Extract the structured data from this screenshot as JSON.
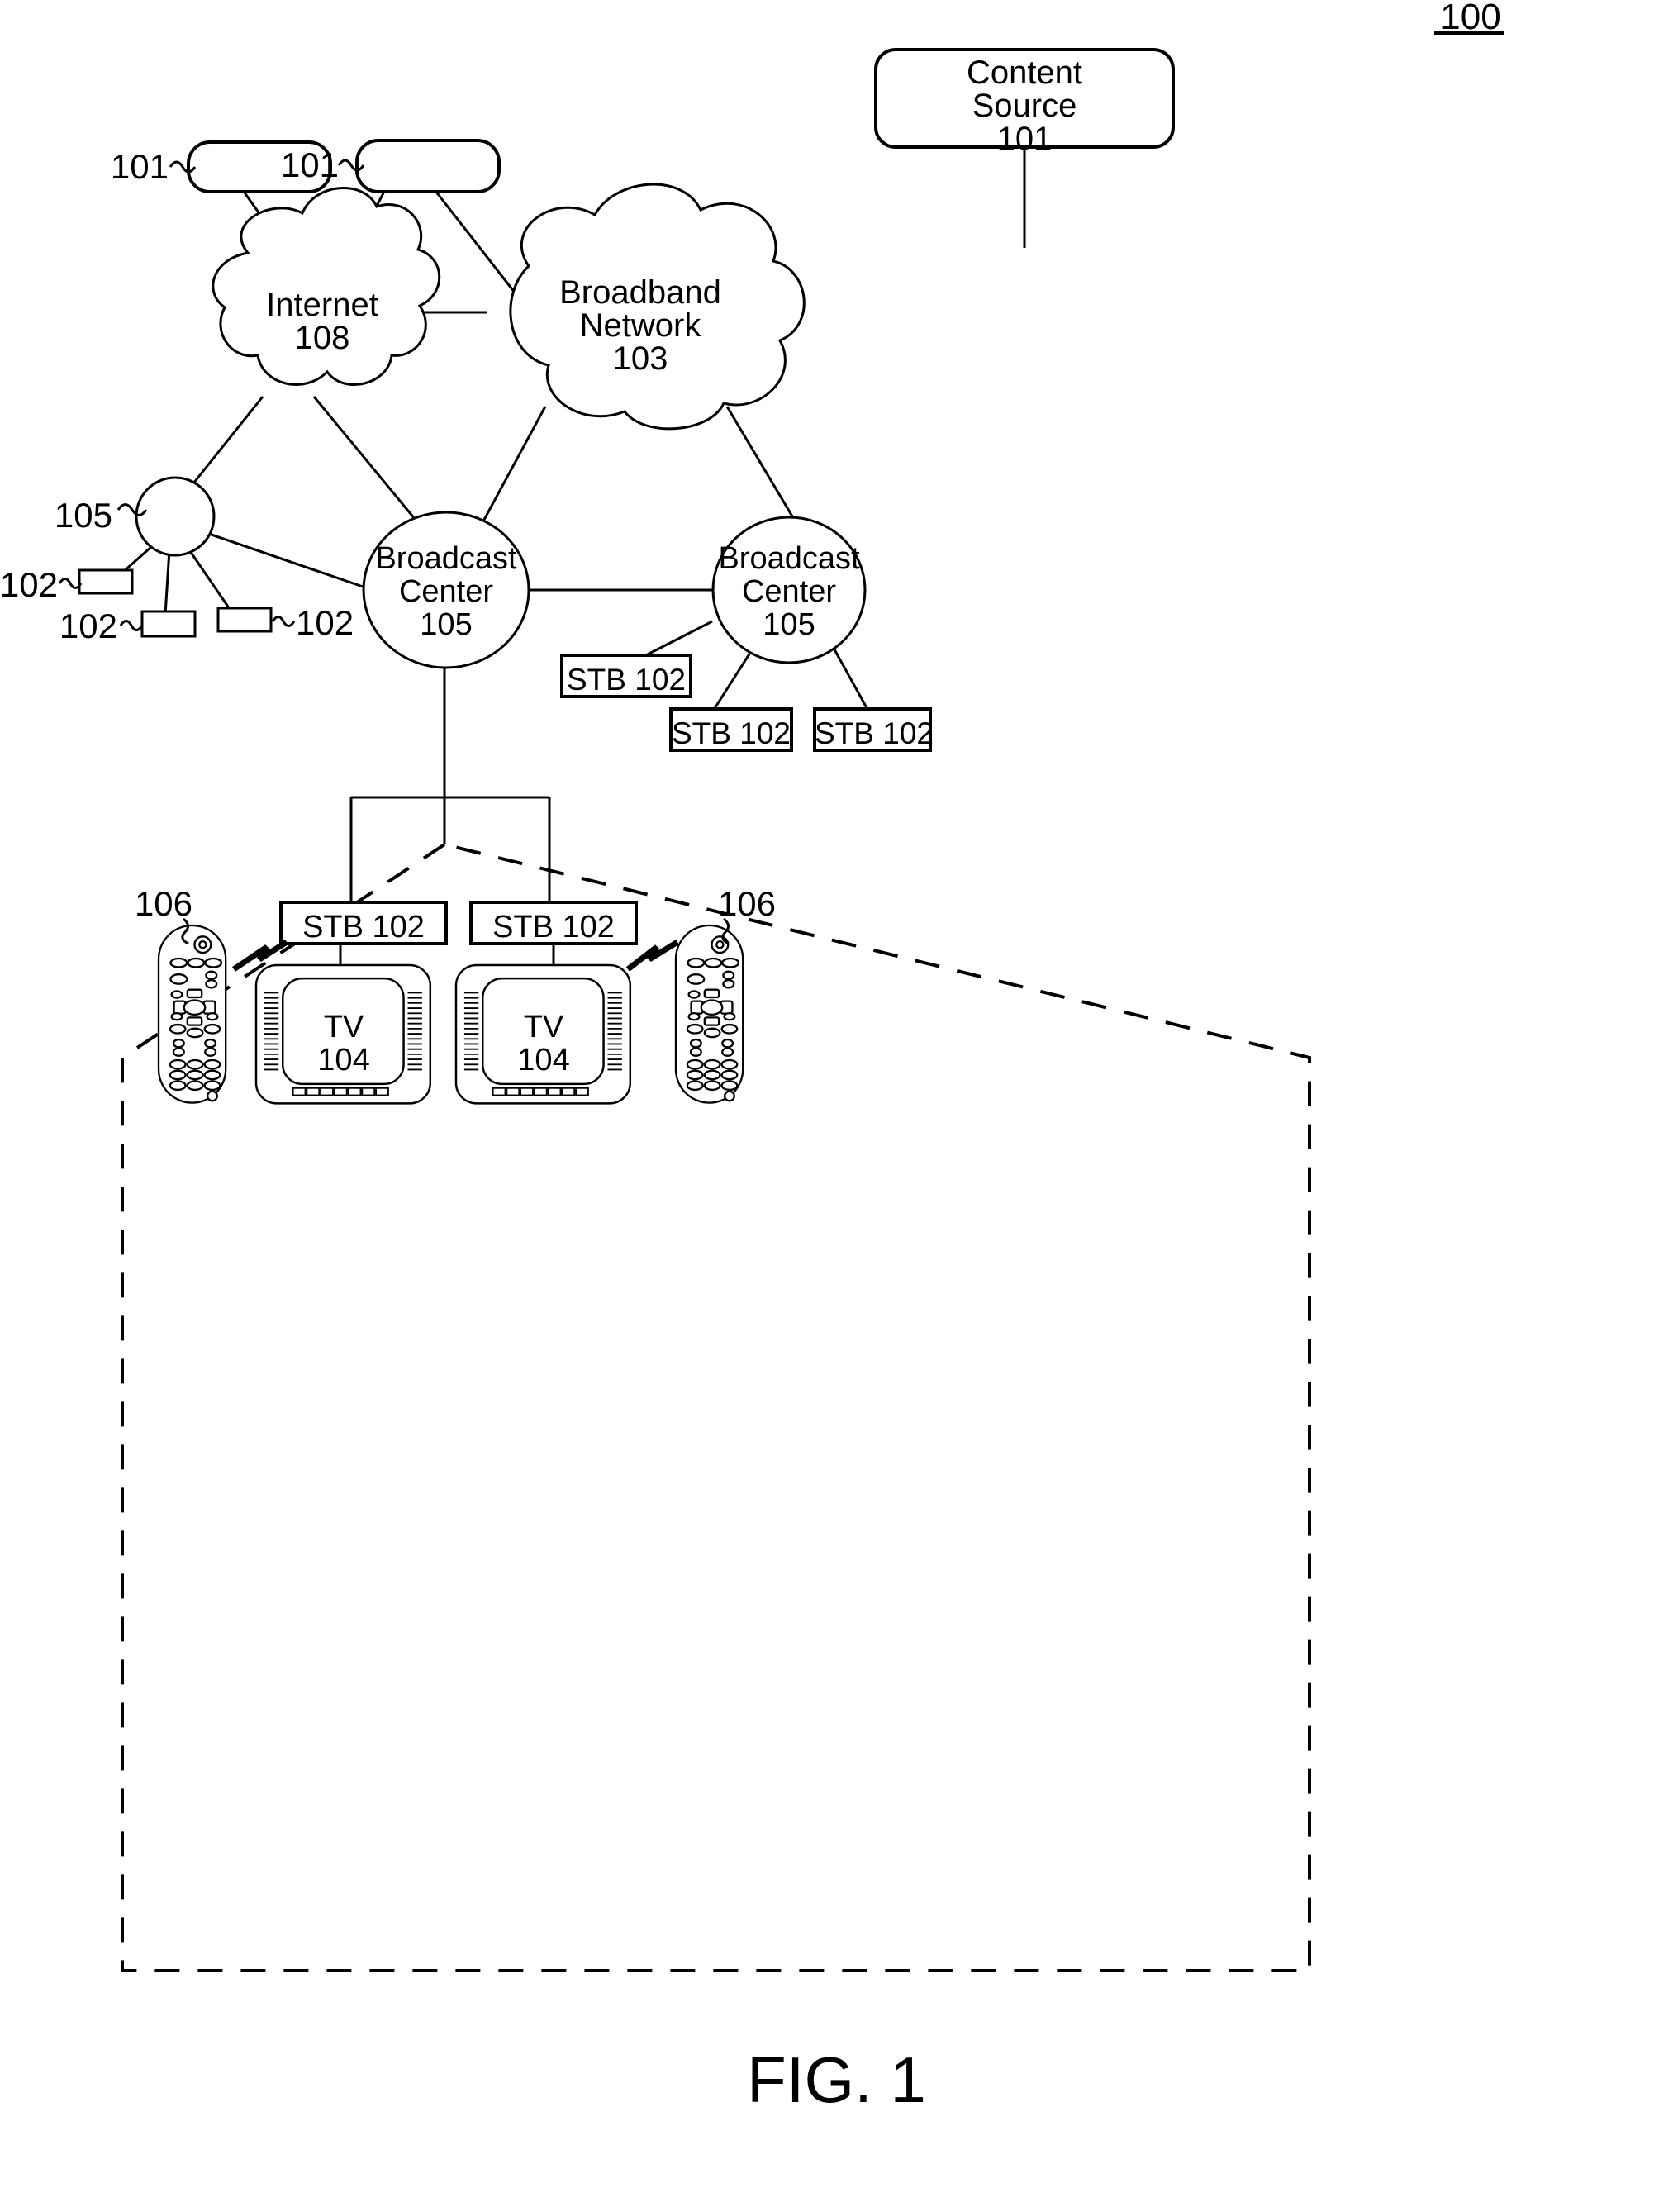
{
  "figure": {
    "caption": "FIG. 1",
    "system_number": "100"
  },
  "nodes": {
    "content_source": {
      "name": "Content Source",
      "ref": "101",
      "line1": "Content",
      "line2": "Source",
      "line3": "101"
    },
    "content_source_alt_left": {
      "ref": "101"
    },
    "content_source_alt_right": {
      "ref": "101"
    },
    "internet": {
      "name": "Internet",
      "ref": "108",
      "line1": "Internet",
      "line2": "108"
    },
    "broadband_network": {
      "name": "Broadband Network",
      "ref": "103",
      "line1": "Broadband",
      "line2": "Network",
      "line3": "103"
    },
    "broadcast_center_unlabeled": {
      "ref": "105"
    },
    "broadcast_center_center": {
      "name": "Broadcast Center",
      "ref": "105",
      "line1": "Broadcast",
      "line2": "Center",
      "line3": "105"
    },
    "broadcast_center_right": {
      "name": "Broadcast Center",
      "ref": "105",
      "line1": "Broadcast",
      "line2": "Center",
      "line3": "105"
    }
  },
  "stb_plain_refs": [
    {
      "ref": "102",
      "position": "left-upper"
    },
    {
      "ref": "102",
      "position": "left-lower"
    },
    {
      "ref": "102",
      "position": "right-lower"
    }
  ],
  "stb_boxes": [
    {
      "label": "STB 102",
      "position": "center-right-of-broadcast-center"
    },
    {
      "label": "STB 102",
      "position": "right-cluster-left"
    },
    {
      "label": "STB 102",
      "position": "right-cluster-right"
    },
    {
      "label": "STB 102",
      "position": "premises-left"
    },
    {
      "label": "STB 102",
      "position": "premises-right"
    }
  ],
  "televisions": [
    {
      "line1": "TV",
      "line2": "104",
      "ref": "104",
      "position": "premises-left"
    },
    {
      "line1": "TV",
      "line2": "104",
      "ref": "104",
      "position": "premises-right"
    }
  ],
  "remotes": [
    {
      "ref": "106",
      "position": "premises-left"
    },
    {
      "ref": "106",
      "position": "premises-right"
    }
  ],
  "premises": {
    "outline_style": "dashed-house",
    "description": "Customer premises boundary"
  },
  "style": {
    "stroke": "#000000",
    "background": "#ffffff",
    "stroke_width": 3
  }
}
